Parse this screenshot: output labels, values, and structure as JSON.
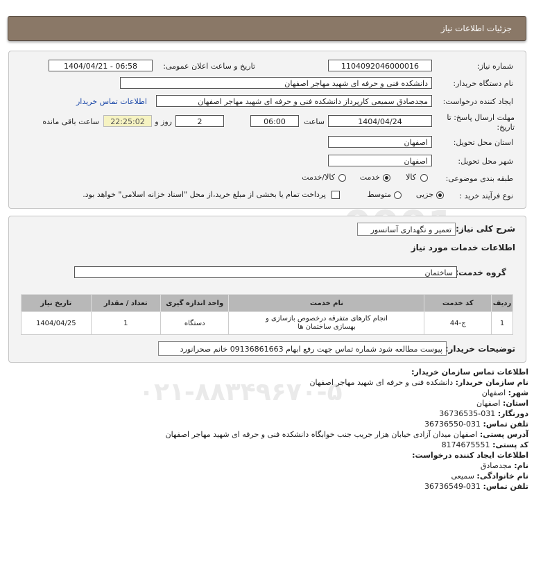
{
  "header": {
    "title": "جزئیات اطلاعات نیاز"
  },
  "form": {
    "need_number_label": "شماره نیاز:",
    "need_number": "1104092046000016",
    "announce_label": "تاریخ و ساعت اعلان عمومی:",
    "announce_value": "1404/04/21 - 06:58",
    "buyer_org_label": "نام دستگاه خریدار:",
    "buyer_org": "دانشکده فنی و حرفه ای شهید مهاجر اصفهان",
    "requester_label": "ایجاد کننده درخواست:",
    "requester": "مجدصادق سمیعی کارپرداز دانشکده فنی و حرفه ای شهید مهاجر اصفهان",
    "contact_link": "اطلاعات تماس خریدار",
    "deadline_label": "مهلت ارسال پاسخ: تا تاریخ:",
    "deadline_date": "1404/04/24",
    "time_label": "ساعت",
    "deadline_time": "06:00",
    "days_value": "2",
    "days_label": "روز و",
    "remaining_time": "22:25:02",
    "remaining_label": "ساعت باقی مانده",
    "province_label": "استان محل تحویل:",
    "province": "اصفهان",
    "city_label": "شهر محل تحویل:",
    "city": "اصفهان",
    "category_label": "طبقه بندی موضوعی:",
    "category_options": [
      "کالا",
      "خدمت",
      "کالا/خدمت"
    ],
    "category_selected": "خدمت",
    "process_label": "نوع فرآیند خرید :",
    "process_options": [
      "جزیی",
      "متوسط"
    ],
    "process_selected": "جزیی",
    "payment_note": "پرداخت تمام یا بخشی از مبلغ خرید،از محل \"اسناد خزانه اسلامی\" خواهد بود."
  },
  "details": {
    "summary_label": "شرح کلی نیاز:",
    "summary": "تعمیر و نگهداری آسانسور",
    "services_title": "اطلاعات خدمات مورد نیاز",
    "service_group_label": "گروه خدمت:",
    "service_group": "ساختمان",
    "table": {
      "headers": [
        "ردیف",
        "کد خدمت",
        "نام خدمت",
        "واحد اندازه گیری",
        "تعداد / مقدار",
        "تاریخ نیاز"
      ],
      "rows": [
        [
          "1",
          "ج-44",
          "انجام کارهای متفرقه درخصوص بازسازی و بهسازی ساختمان ها",
          "دستگاه",
          "1",
          "1404/04/25"
        ]
      ]
    },
    "buyer_notes_label": "توضیحات خریدار:",
    "buyer_notes": "پیوست مطالعه شود شماره تماس جهت رفع ابهام 09136861663 خانم صحرانورد"
  },
  "contact": {
    "org_title": "اطلاعات تماس سازمان خریدار:",
    "org_name_label": "نام سازمان خریدار:",
    "org_name": "دانشکده فنی و حرفه ای شهید مهاجر اصفهان",
    "city_label": "شهر:",
    "city": "اصفهان",
    "province_label": "استان:",
    "province": "اصفهان",
    "fax_label": "دورنگار:",
    "fax": "031-36736535",
    "phone_label": "تلفن تماس:",
    "phone": "031-36736550",
    "address_label": "آدرس پستی:",
    "address": "اصفهان میدان آزادی خیابان هزار جریب جنب خوابگاه دانشکده فنی و حرفه ای شهید مهاجر اصفهان",
    "postal_label": "کد پستی:",
    "postal": "8174675551",
    "creator_title": "اطلاعات ایجاد کننده درخواست:",
    "first_name_label": "نام:",
    "first_name": "مجدصادق",
    "last_name_label": "نام خانوادگی:",
    "last_name": "سمیعی",
    "creator_phone_label": "تلفن تماس:",
    "creator_phone": "031-36736549"
  }
}
